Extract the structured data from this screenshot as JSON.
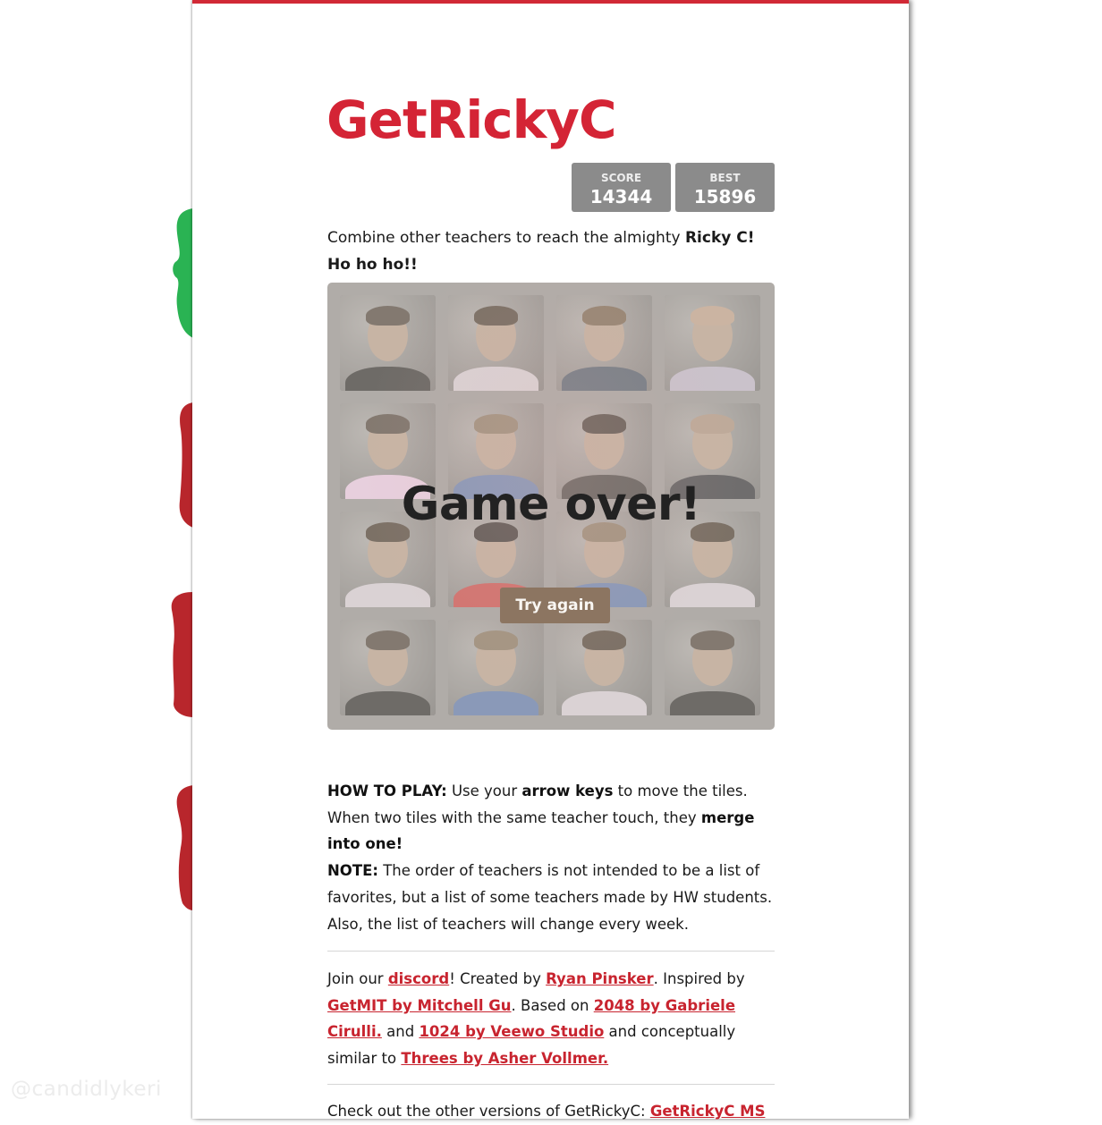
{
  "watermark": "@candidlykeri",
  "title": "GetRickyC",
  "scores": {
    "score_label": "SCORE",
    "score": "14344",
    "best_label": "BEST",
    "best": "15896"
  },
  "intro": {
    "text": "Combine other teachers to reach the almighty ",
    "bold": "Ricky C! Ho ho ho!!"
  },
  "game": {
    "message": "Game over!",
    "retry": "Try again"
  },
  "tiles": [
    {
      "hair": "#4a4038",
      "shirt": "#2a2a2a"
    },
    {
      "hair": "#3f3329",
      "shirt": "#cfc8d2"
    },
    {
      "hair": "#6b5540",
      "shirt": "#3b4a5c"
    },
    {
      "hair": "#b89a85",
      "shirt": "#b7b0c4"
    },
    {
      "hair": "#4a4038",
      "shirt": "#e3c3df"
    },
    {
      "hair": "#7d6a55",
      "shirt": "#5571a6"
    },
    {
      "hair": "#2b2420",
      "shirt": "#2d2d2d"
    },
    {
      "hair": "#a58b78",
      "shirt": "#2b2d33"
    },
    {
      "hair": "#3f3329",
      "shirt": "#cfc8d2"
    },
    {
      "hair": "#1e1a19",
      "shirt": "#c23a3a"
    },
    {
      "hair": "#7d6a55",
      "shirt": "#5571a6"
    },
    {
      "hair": "#3f3329",
      "shirt": "#cfc8d2"
    },
    {
      "hair": "#4a4038",
      "shirt": "#2a2a2a"
    },
    {
      "hair": "#7d6a55",
      "shirt": "#5571a6"
    },
    {
      "hair": "#3f3329",
      "shirt": "#cfc8d2"
    },
    {
      "hair": "#4a4038",
      "shirt": "#2a2a2a"
    }
  ],
  "how_to": {
    "label": "HOW TO PLAY:",
    "t1": " Use your ",
    "b1": "arrow keys",
    "t2": " to move the tiles. When two tiles with the same teacher touch, they ",
    "b2": "merge into one!",
    "note_label": "NOTE:",
    "note": " The order of teachers is not intended to be a list of favorites, but a list of some teachers made by HW students. Also, the list of teachers will change every week."
  },
  "credits": {
    "t1": "Join our ",
    "discord": "discord",
    "t2": "! Created by ",
    "author": "Ryan Pinsker",
    "t3": ". Inspired by ",
    "getmit": "GetMIT by Mitchell Gu",
    "t4": ". Based on ",
    "orig": "2048 by Gabriele Cirulli.",
    "t5": " and ",
    "veewo": "1024 by Veewo Studio",
    "t6": " and conceptually similar to ",
    "threes": "Threes by Asher Vollmer."
  },
  "other": {
    "text": "Check out the other versions of GetRickyC: ",
    "link": "GetRickyC MS"
  },
  "colors": {
    "accent": "#d42435",
    "button": "#8c7561",
    "board": "#b0aca8",
    "green_shape": "#2ab353",
    "red_shape": "#b8262c"
  }
}
